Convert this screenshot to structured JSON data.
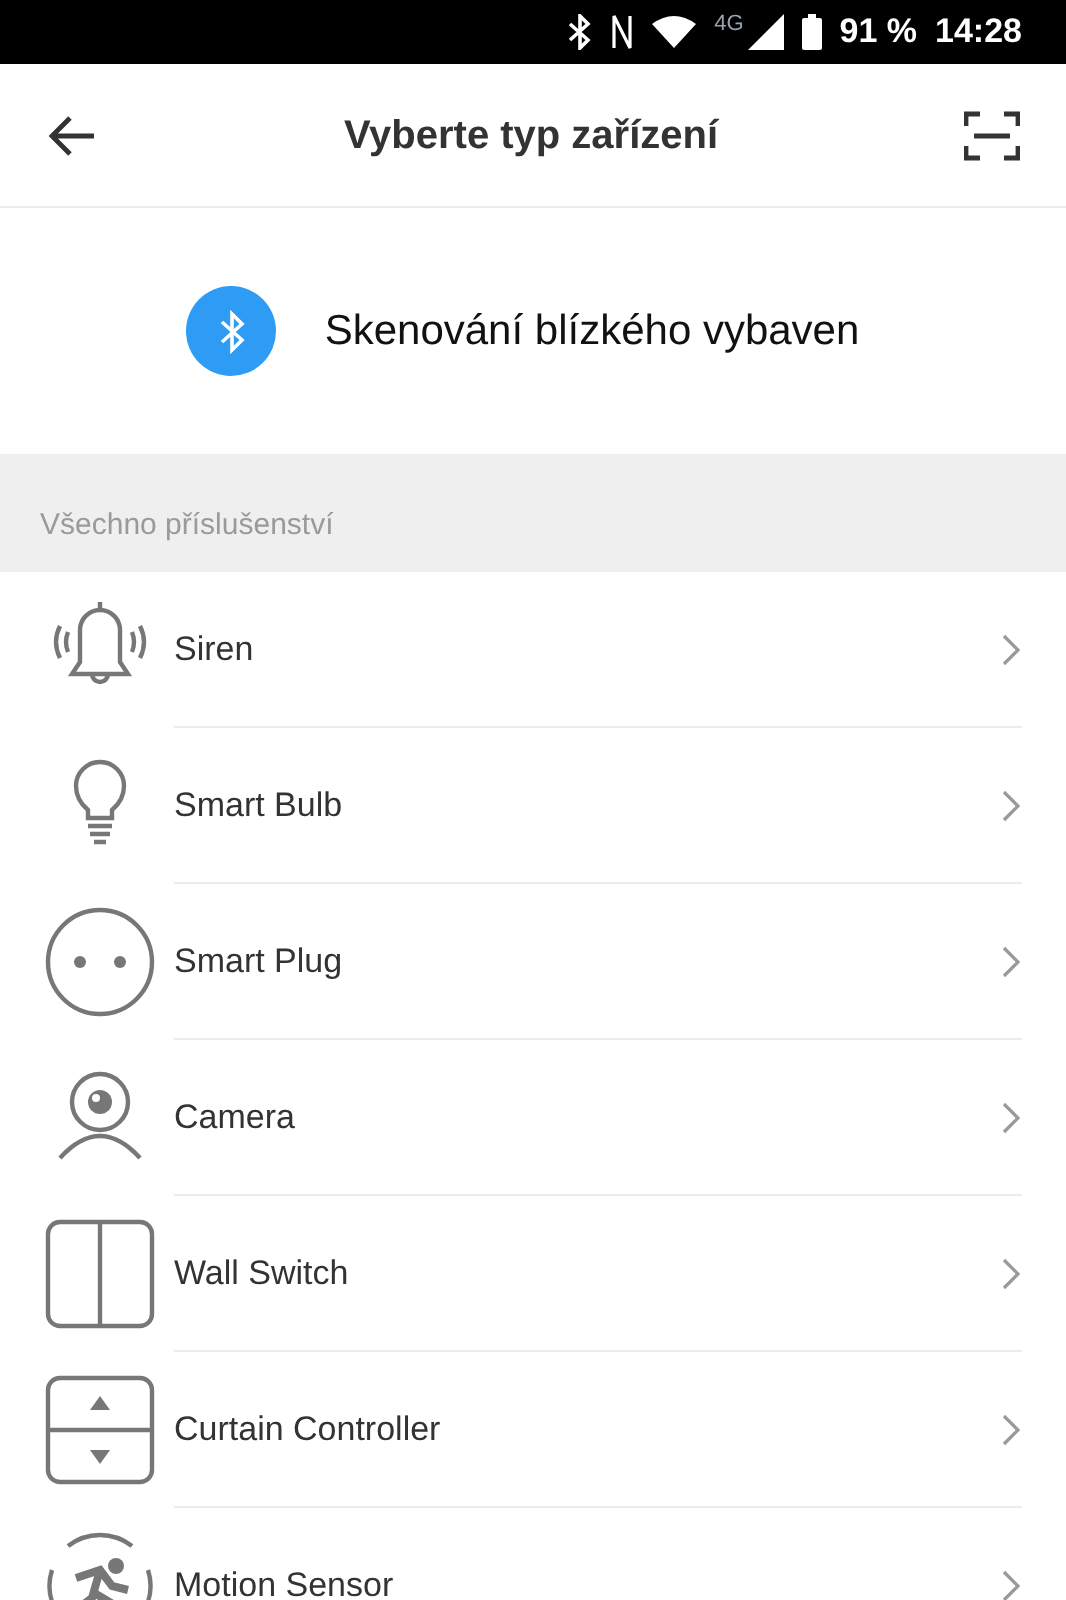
{
  "status_bar": {
    "network": "4G",
    "battery": "91 %",
    "time": "14:28"
  },
  "header": {
    "title": "Vyberte typ zařízení"
  },
  "scan": {
    "label": "Skenování blízkého vybaven"
  },
  "section": {
    "title": "Všechno příslušenství"
  },
  "devices": [
    {
      "kind": "siren",
      "label": "Siren"
    },
    {
      "kind": "bulb",
      "label": "Smart Bulb"
    },
    {
      "kind": "plug",
      "label": "Smart Plug"
    },
    {
      "kind": "camera",
      "label": "Camera"
    },
    {
      "kind": "switch",
      "label": "Wall Switch"
    },
    {
      "kind": "curtain",
      "label": "Curtain Controller"
    },
    {
      "kind": "motion",
      "label": "Motion Sensor"
    }
  ]
}
